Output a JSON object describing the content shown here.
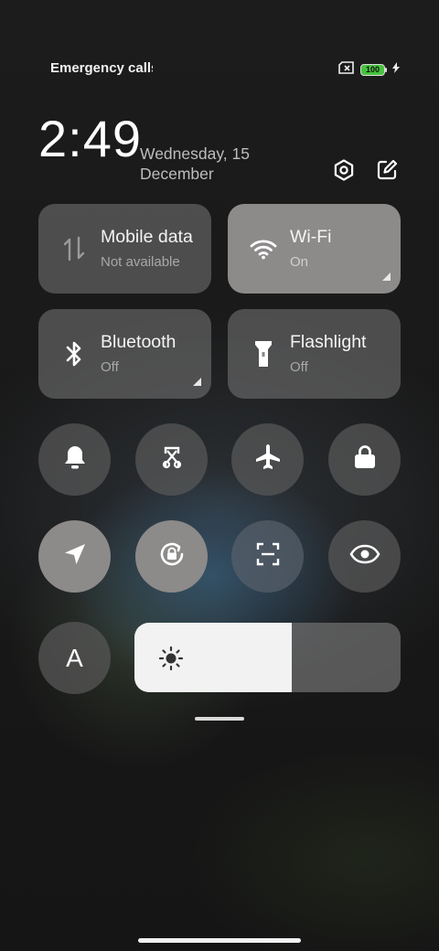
{
  "status_bar": {
    "carrier_text": "Emergency calls",
    "battery_level": "100",
    "charging": true
  },
  "header": {
    "time": "2:49",
    "date": "Wednesday, 15 December"
  },
  "tiles": [
    {
      "label": "Mobile data",
      "status": "Not available",
      "icon": "mobile-data-icon",
      "active": false
    },
    {
      "label": "Wi-Fi",
      "status": "On",
      "icon": "wifi-icon",
      "active": true
    },
    {
      "label": "Bluetooth",
      "status": "Off",
      "icon": "bluetooth-icon",
      "active": false
    },
    {
      "label": "Flashlight",
      "status": "Off",
      "icon": "flashlight-icon",
      "active": false
    }
  ],
  "toggles_row1": [
    "bell-icon",
    "screenshot-icon",
    "airplane-icon",
    "lock-icon"
  ],
  "toggles_row2": [
    "location-icon",
    "rotation-lock-icon",
    "scanner-icon",
    "eye-icon"
  ],
  "auto_brightness_label": "A",
  "brightness_percent": 59,
  "colors": {
    "tile_on": "#8d8a8a",
    "tile_off": "#5e5e5e",
    "battery": "#46c33e"
  }
}
